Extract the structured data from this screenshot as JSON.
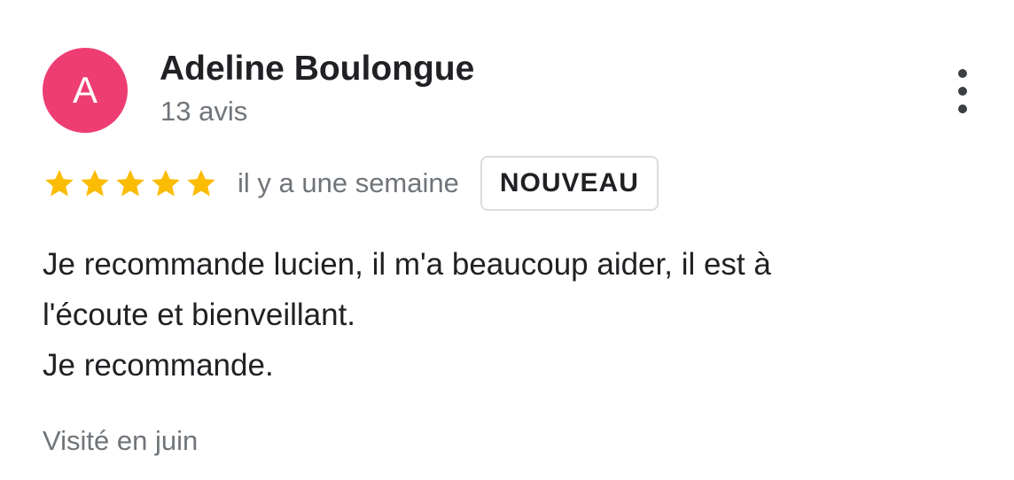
{
  "review": {
    "avatar_letter": "A",
    "avatar_color": "#ee3d72",
    "author_name": "Adeline Boulongue",
    "review_count": "13 avis",
    "rating": 5,
    "rating_max": 5,
    "star_color": "#fbbc04",
    "date": "il y a une semaine",
    "badge": "NOUVEAU",
    "text_lines": [
      "Je recommande lucien, il m'a beaucoup aider, il est à",
      "l'écoute et bienveillant.",
      "Je recommande."
    ],
    "visit": "Visité en juin"
  },
  "icons": {
    "menu": "more-vert-icon",
    "star": "star-icon"
  }
}
